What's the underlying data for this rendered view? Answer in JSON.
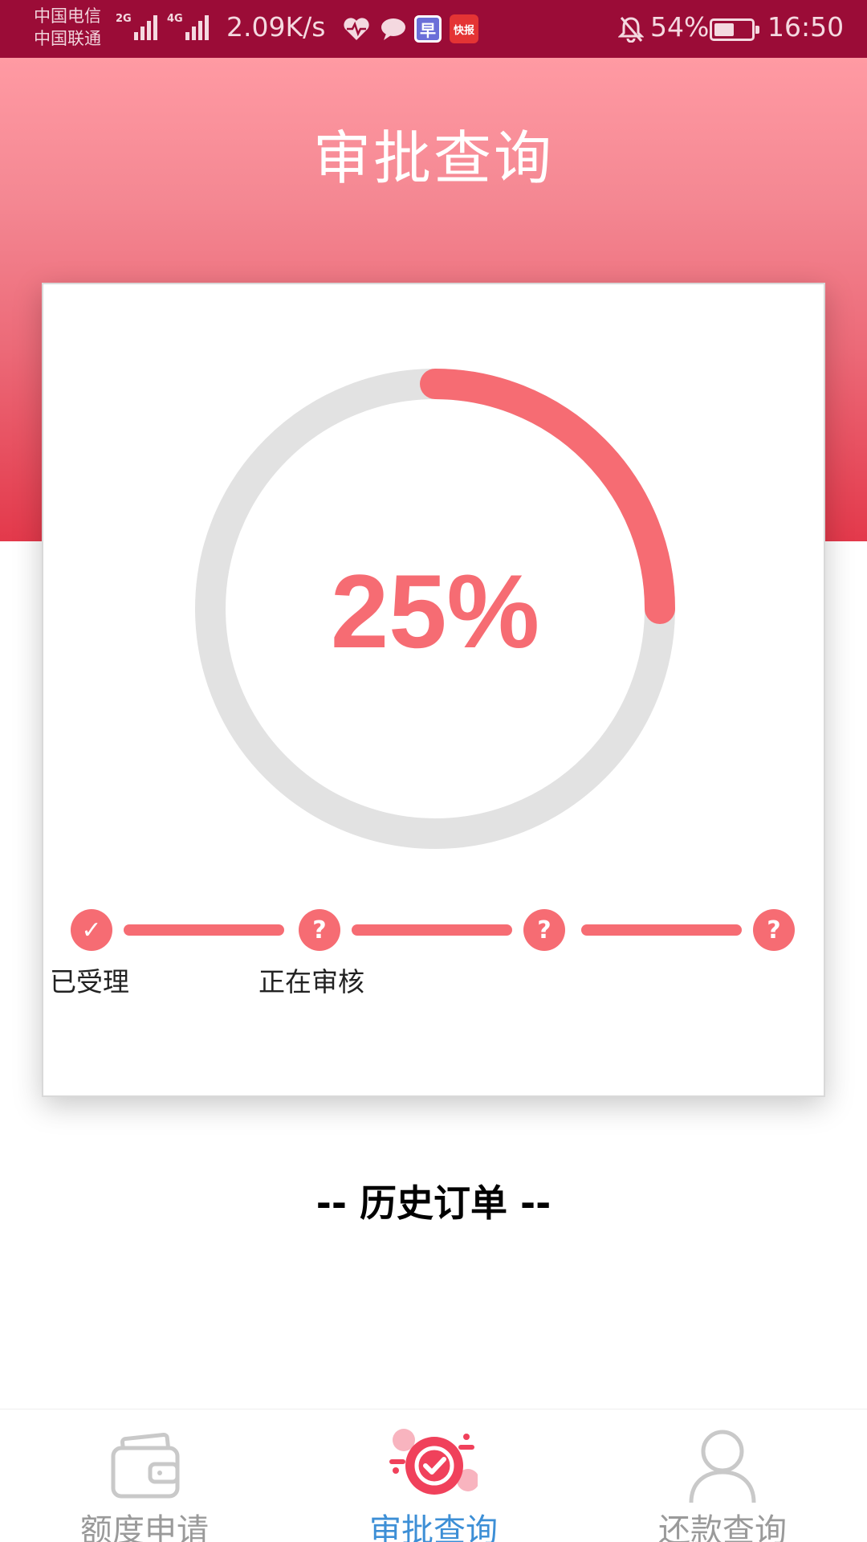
{
  "status_bar": {
    "carrier_1": "中国电信",
    "carrier_2": "中国联通",
    "signal_1_tag": "2G",
    "signal_2_tag": "4G",
    "net_speed": "2.09K/s",
    "app_icon_1_text": "早",
    "app_icon_2_text": "快报",
    "battery_percent": "54%",
    "battery_level": 0.54,
    "time": "16:50"
  },
  "header": {
    "title": "审批查询"
  },
  "progress": {
    "value": 0.25,
    "label": "25%",
    "track_color": "#e2e2e2",
    "fill_color": "#f66c73"
  },
  "steps": [
    {
      "label": "已受理",
      "state": "done",
      "symbol": "✓"
    },
    {
      "label": "正在审核",
      "state": "pending",
      "symbol": "?"
    },
    {
      "label": "",
      "state": "pending",
      "symbol": "?"
    },
    {
      "label": "",
      "state": "pending",
      "symbol": "?"
    }
  ],
  "history": {
    "title": "-- 历史订单 --"
  },
  "bottom_nav": {
    "items": [
      {
        "label": "额度申请",
        "icon": "wallet-icon",
        "active": false
      },
      {
        "label": "审批查询",
        "icon": "approval-check-icon",
        "active": true
      },
      {
        "label": "还款查询",
        "icon": "user-icon",
        "active": false
      }
    ]
  },
  "colors": {
    "status_bar": "#9b0c37",
    "accent": "#f66c73",
    "nav_active": "#3d8fd6",
    "nav_inactive": "#9a9a9a"
  }
}
